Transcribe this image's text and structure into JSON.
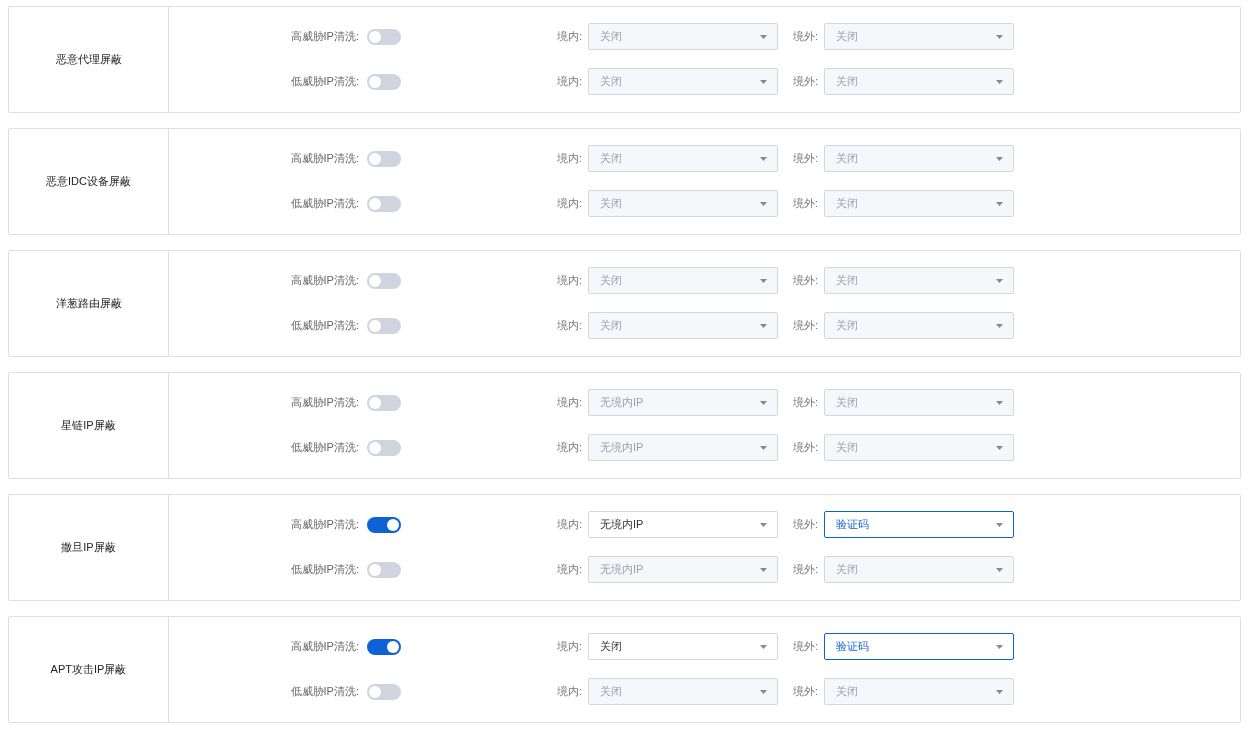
{
  "sections": [
    {
      "title": "恶意代理屏蔽",
      "rows": [
        {
          "label": "高威胁IP清洗:",
          "on": false,
          "domestic": {
            "label": "境内:",
            "value": "关闭",
            "disabled": true,
            "highlighted": false
          },
          "overseas": {
            "label": "境外:",
            "value": "关闭",
            "disabled": true,
            "highlighted": false
          }
        },
        {
          "label": "低威胁IP清洗:",
          "on": false,
          "domestic": {
            "label": "境内:",
            "value": "关闭",
            "disabled": true,
            "highlighted": false
          },
          "overseas": {
            "label": "境外:",
            "value": "关闭",
            "disabled": true,
            "highlighted": false
          }
        }
      ]
    },
    {
      "title": "恶意IDC设备屏蔽",
      "rows": [
        {
          "label": "高威胁IP清洗:",
          "on": false,
          "domestic": {
            "label": "境内:",
            "value": "关闭",
            "disabled": true,
            "highlighted": false
          },
          "overseas": {
            "label": "境外:",
            "value": "关闭",
            "disabled": true,
            "highlighted": false
          }
        },
        {
          "label": "低威胁IP清洗:",
          "on": false,
          "domestic": {
            "label": "境内:",
            "value": "关闭",
            "disabled": true,
            "highlighted": false
          },
          "overseas": {
            "label": "境外:",
            "value": "关闭",
            "disabled": true,
            "highlighted": false
          }
        }
      ]
    },
    {
      "title": "洋葱路由屏蔽",
      "rows": [
        {
          "label": "高威胁IP清洗:",
          "on": false,
          "domestic": {
            "label": "境内:",
            "value": "关闭",
            "disabled": true,
            "highlighted": false
          },
          "overseas": {
            "label": "境外:",
            "value": "关闭",
            "disabled": true,
            "highlighted": false
          }
        },
        {
          "label": "低威胁IP清洗:",
          "on": false,
          "domestic": {
            "label": "境内:",
            "value": "关闭",
            "disabled": true,
            "highlighted": false
          },
          "overseas": {
            "label": "境外:",
            "value": "关闭",
            "disabled": true,
            "highlighted": false
          }
        }
      ]
    },
    {
      "title": "星链IP屏蔽",
      "rows": [
        {
          "label": "高威胁IP清洗:",
          "on": false,
          "domestic": {
            "label": "境内:",
            "value": "无境内IP",
            "disabled": true,
            "highlighted": false
          },
          "overseas": {
            "label": "境外:",
            "value": "关闭",
            "disabled": true,
            "highlighted": false
          }
        },
        {
          "label": "低威胁IP清洗:",
          "on": false,
          "domestic": {
            "label": "境内:",
            "value": "无境内IP",
            "disabled": true,
            "highlighted": false
          },
          "overseas": {
            "label": "境外:",
            "value": "关闭",
            "disabled": true,
            "highlighted": false
          }
        }
      ]
    },
    {
      "title": "撒旦IP屏蔽",
      "rows": [
        {
          "label": "高威胁IP清洗:",
          "on": true,
          "domestic": {
            "label": "境内:",
            "value": "无境内IP",
            "disabled": false,
            "highlighted": false
          },
          "overseas": {
            "label": "境外:",
            "value": "验证码",
            "disabled": false,
            "highlighted": true
          }
        },
        {
          "label": "低威胁IP清洗:",
          "on": false,
          "domestic": {
            "label": "境内:",
            "value": "无境内IP",
            "disabled": true,
            "highlighted": false
          },
          "overseas": {
            "label": "境外:",
            "value": "关闭",
            "disabled": true,
            "highlighted": false
          }
        }
      ]
    },
    {
      "title": "APT攻击IP屏蔽",
      "rows": [
        {
          "label": "高威胁IP清洗:",
          "on": true,
          "domestic": {
            "label": "境内:",
            "value": "关闭",
            "disabled": false,
            "highlighted": false
          },
          "overseas": {
            "label": "境外:",
            "value": "验证码",
            "disabled": false,
            "highlighted": true
          }
        },
        {
          "label": "低威胁IP清洗:",
          "on": false,
          "domestic": {
            "label": "境内:",
            "value": "关闭",
            "disabled": true,
            "highlighted": false
          },
          "overseas": {
            "label": "境外:",
            "value": "关闭",
            "disabled": true,
            "highlighted": false
          }
        }
      ]
    }
  ]
}
